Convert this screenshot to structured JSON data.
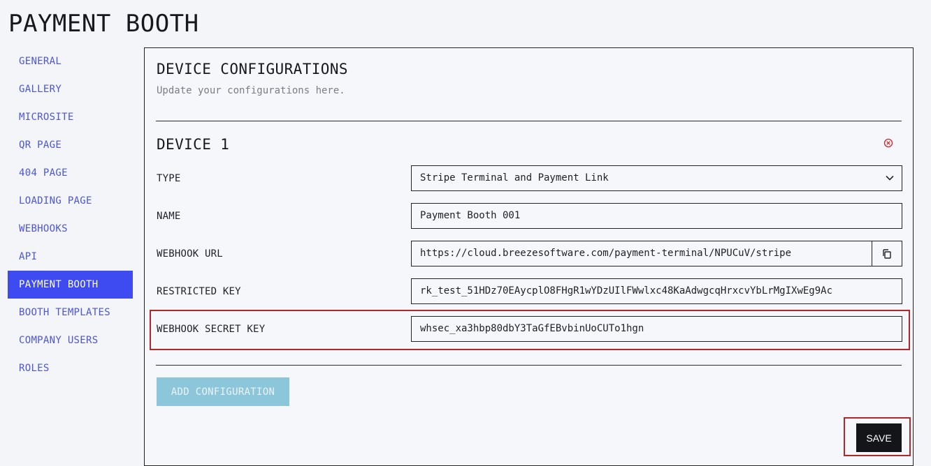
{
  "page": {
    "title": "PAYMENT BOOTH"
  },
  "sidebar": {
    "items": [
      {
        "label": "GENERAL"
      },
      {
        "label": "GALLERY"
      },
      {
        "label": "MICROSITE"
      },
      {
        "label": "QR PAGE"
      },
      {
        "label": "404 PAGE"
      },
      {
        "label": "LOADING PAGE"
      },
      {
        "label": "WEBHOOKS"
      },
      {
        "label": "API"
      },
      {
        "label": "PAYMENT BOOTH"
      },
      {
        "label": "BOOTH TEMPLATES"
      },
      {
        "label": "COMPANY USERS"
      },
      {
        "label": "ROLES"
      }
    ],
    "active": "PAYMENT BOOTH"
  },
  "panel": {
    "title": "DEVICE CONFIGURATIONS",
    "subtitle": "Update your configurations here."
  },
  "device": {
    "title": "DEVICE 1",
    "fields": {
      "type": {
        "label": "TYPE",
        "value": "Stripe Terminal and Payment Link"
      },
      "name": {
        "label": "NAME",
        "value": "Payment Booth 001"
      },
      "webhook_url": {
        "label": "WEBHOOK URL",
        "value": "https://cloud.breezesoftware.com/payment-terminal/NPUCuV/stripe"
      },
      "restricted_key": {
        "label": "RESTRICTED KEY",
        "value": "rk_test_51HDz70EAycplO8FHgR1wYDzUIlFWwlxc48KaAdwgcqHrxcvYbLrMgIXwEg9Ac"
      },
      "webhook_secret_key": {
        "label": "WEBHOOK SECRET KEY",
        "value": "whsec_xa3hbp80dbY3TaGfEBvbinUoCUTo1hgn"
      }
    }
  },
  "actions": {
    "add_configuration": "ADD CONFIGURATION",
    "save": "SAVE"
  },
  "colors": {
    "accent": "#3d4bf1",
    "sidebar_text": "#4c56d6",
    "add_button": "#8cc6db",
    "highlight": "#b3262a",
    "remove_icon": "#d0262d"
  },
  "icons": {
    "remove": "close-circle-icon",
    "dropdown": "chevron-down-icon",
    "copy": "copy-icon"
  }
}
